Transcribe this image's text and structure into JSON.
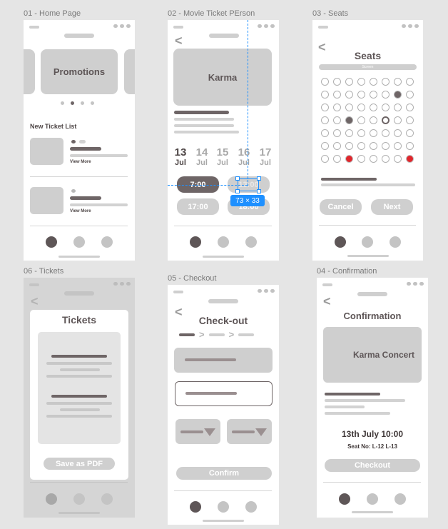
{
  "frames": {
    "home": {
      "label": "01 - Home Page",
      "promo": "Promotions",
      "section_title": "New Ticket List",
      "view_more_1": "View More",
      "view_more_2": "View More"
    },
    "movie": {
      "label": "02 - Movie Ticket PErson",
      "poster": "Karma",
      "dates": [
        {
          "day": "13",
          "month": "Jul"
        },
        {
          "day": "14",
          "month": "Jul"
        },
        {
          "day": "15",
          "month": "Jul"
        },
        {
          "day": "16",
          "month": "Jul"
        },
        {
          "day": "17",
          "month": "Jul"
        }
      ],
      "time_1": "7:00",
      "time_2": "13:00",
      "time_3": "17:00",
      "time_4": "18:00",
      "measure": "73 × 33"
    },
    "seats": {
      "label": "03 - Seats",
      "title": "Seats",
      "screen": "Screen",
      "cancel": "Cancel",
      "next": "Next",
      "grid": [
        [
          "o",
          "o",
          "o",
          "o",
          "o",
          "o",
          "o",
          "o"
        ],
        [
          "o",
          "o",
          "o",
          "o",
          "o",
          "o",
          "x",
          "o"
        ],
        [
          "o",
          "o",
          "o",
          "o",
          "o",
          "o",
          "o",
          "o"
        ],
        [
          "o",
          "o",
          "x",
          "o",
          "o",
          "b",
          "o",
          "o"
        ],
        [
          "o",
          "o",
          "o",
          "o",
          "o",
          "o",
          "o",
          "o"
        ],
        [
          "o",
          "o",
          "o",
          "o",
          "o",
          "o",
          "o",
          "o"
        ],
        [
          "o",
          "o",
          "r",
          "o",
          "o",
          "o",
          "o",
          "r"
        ]
      ]
    },
    "tickets": {
      "label": "06 - Tickets",
      "title": "Tickets",
      "save": "Save as PDF"
    },
    "checkout": {
      "label": "05 - Checkout",
      "title": "Check-out",
      "confirm": "Confirm"
    },
    "confirmation": {
      "label": "04 - Confirmation",
      "title": "Confirmation",
      "poster": "Karma Concert",
      "datetime": "13th July 10:00",
      "seat_no": "Seat No: L-12 L-13",
      "checkout": "Checkout"
    }
  },
  "colors": {
    "background": "#e5e5e5",
    "dark": "#6e6566",
    "selected_seat": "#e0262c",
    "measure_blue": "#1e90ff"
  }
}
